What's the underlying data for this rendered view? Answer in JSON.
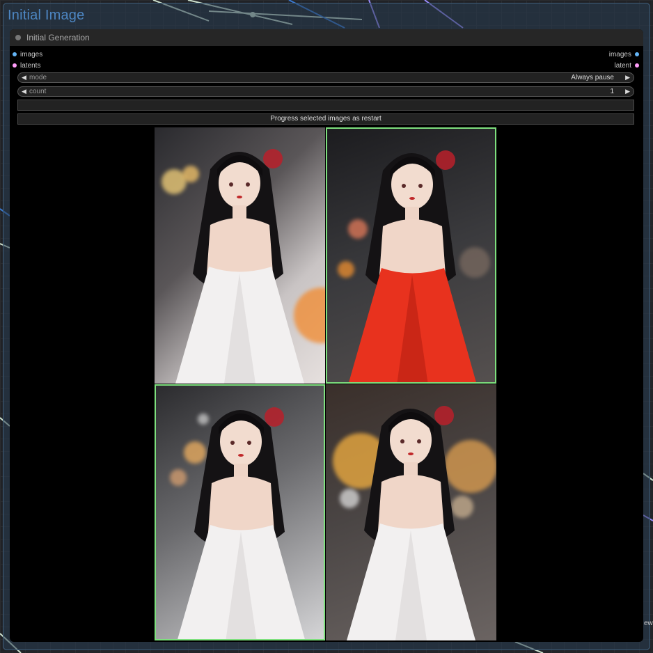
{
  "group": {
    "title": "Initial Image"
  },
  "node": {
    "title": "Initial Generation",
    "inputs": [
      {
        "label": "images",
        "color": "#64b5f6"
      },
      {
        "label": "latents",
        "color": "#ff9cf9"
      }
    ],
    "outputs": [
      {
        "label": "images",
        "color": "#64b5f6"
      },
      {
        "label": "latent",
        "color": "#ff9cf9"
      }
    ],
    "widgets": {
      "mode": {
        "name": "mode",
        "value": "Always pause"
      },
      "count": {
        "name": "count",
        "value": "1"
      }
    },
    "text_field": {
      "value": ""
    },
    "progress_button": {
      "label": "Progress selected images as restart"
    },
    "images": [
      {
        "dress": "white",
        "selected": false
      },
      {
        "dress": "red",
        "selected": true
      },
      {
        "dress": "white",
        "selected": true
      },
      {
        "dress": "white",
        "selected": false
      }
    ]
  },
  "edge_text": "ew",
  "colors": {
    "accent_selected": "#7ee07e",
    "group_title": "#4d86c2",
    "wire_blue": "#3a7bd5",
    "wire_pale": "#c8e0c8",
    "wire_violet": "#9b8cff"
  }
}
